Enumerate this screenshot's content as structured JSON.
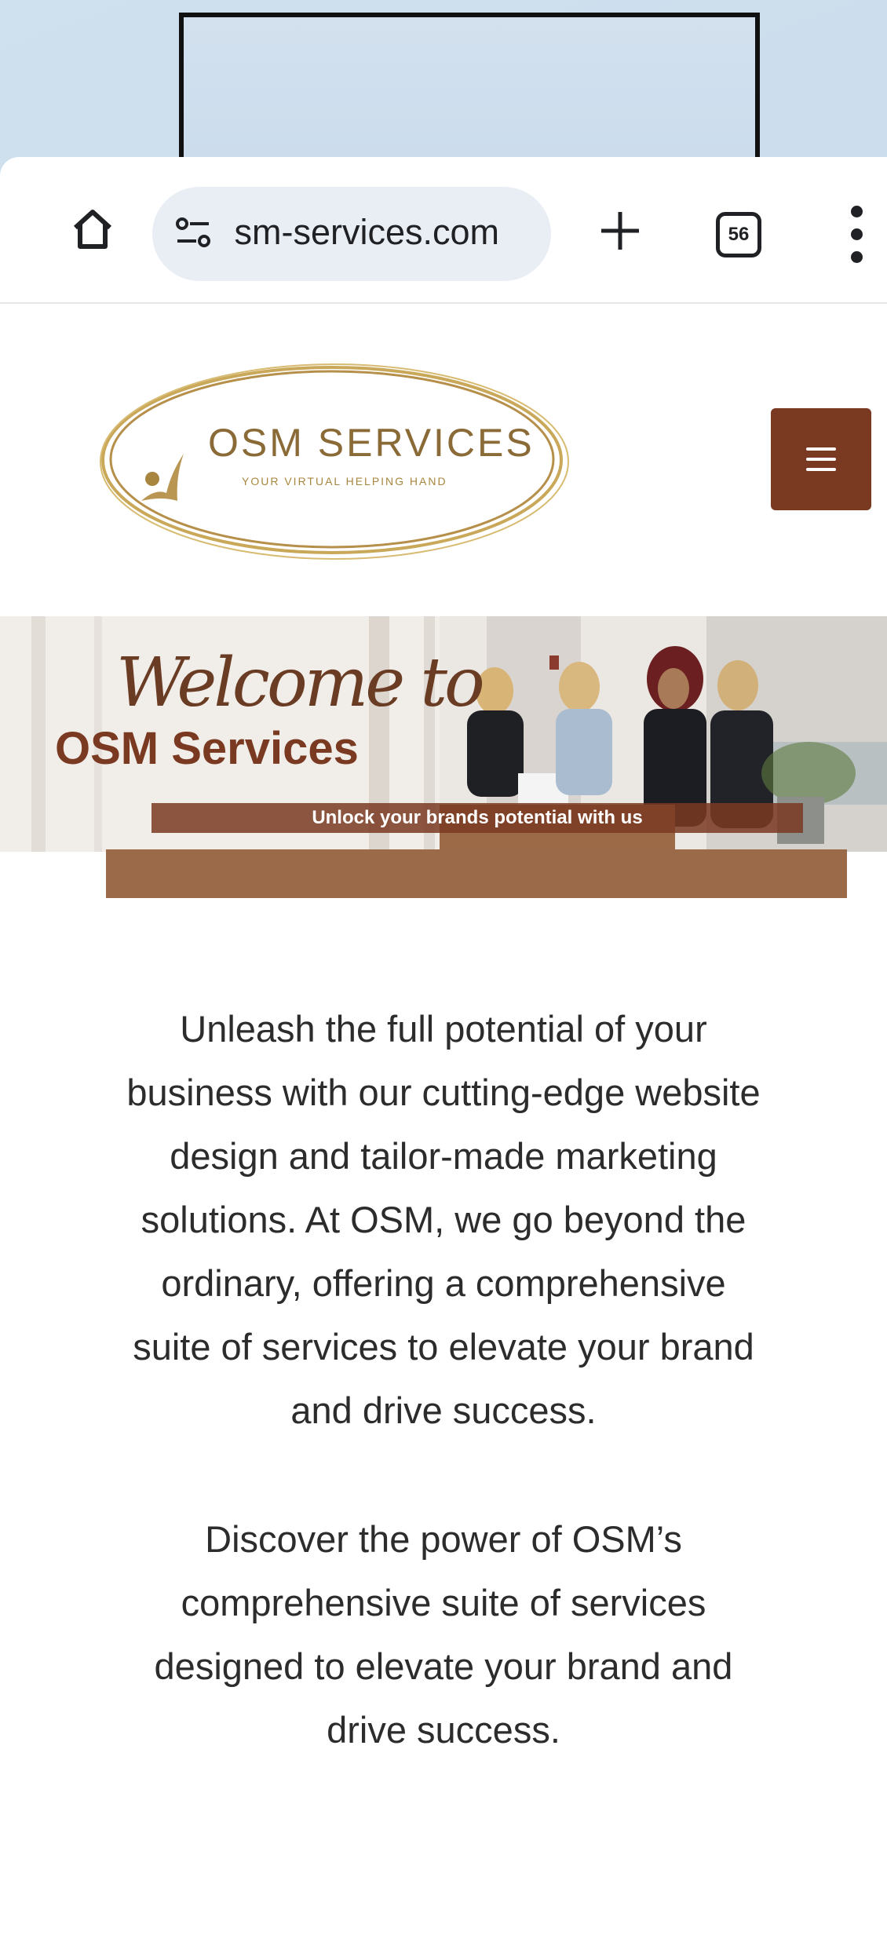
{
  "browser": {
    "url": " sm-services.com",
    "tab_count": "56"
  },
  "logo": {
    "title": "OSM SERVICES",
    "tagline": "YOUR VIRTUAL HELPING HAND"
  },
  "banner": {
    "welcome": "Welcome to",
    "title": "OSM Services",
    "tagline": "Unlock your brands potential with us"
  },
  "content": {
    "paragraph1_lines": [
      "Unleash the full potential of your",
      "business with our cutting-edge website",
      "design and tailor-made marketing",
      "solutions. At OSM, we go beyond the",
      "ordinary, offering a comprehensive",
      "suite of services to elevate your brand",
      "and drive success."
    ],
    "paragraph2_lines": [
      "Discover the power of OSM’s",
      "comprehensive suite of services",
      "designed to elevate your brand and",
      "drive success."
    ]
  },
  "colors": {
    "brand_brown": "#7a3a22",
    "gold": "#b99753",
    "url_pill": "#e9eef5"
  },
  "icons": [
    "home-icon",
    "site-settings-icon",
    "new-tab-icon",
    "tab-switcher-icon",
    "more-options-icon",
    "hamburger-menu-icon"
  ]
}
